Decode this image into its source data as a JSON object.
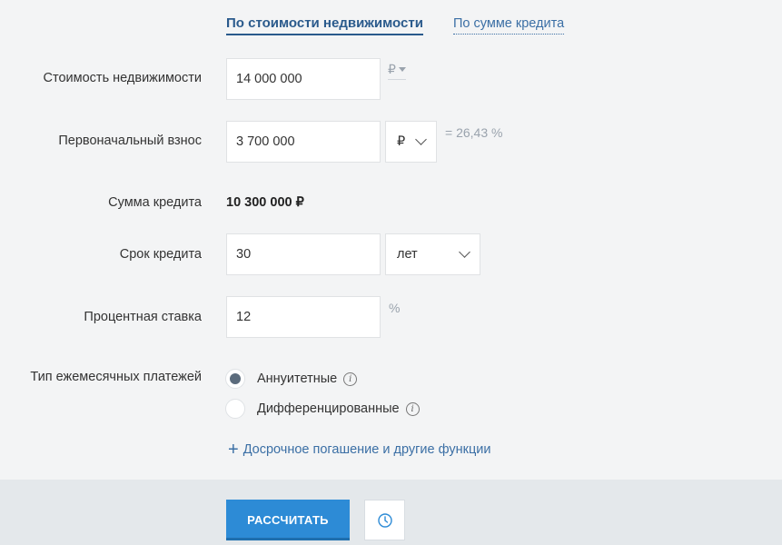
{
  "tabs": {
    "active": "По стоимости недвижимости",
    "other": "По сумме кредита"
  },
  "form": {
    "property_cost": {
      "label": "Стоимость недвижимости",
      "value": "14 000 000",
      "currency": "₽"
    },
    "down_payment": {
      "label": "Первоначальный взнос",
      "value": "3 700 000",
      "unit_selected": "₽",
      "percent_text": "= 26,43 %"
    },
    "loan_amount": {
      "label": "Сумма кредита",
      "value": "10 300 000 ₽"
    },
    "term": {
      "label": "Срок кредита",
      "value": "30",
      "unit_selected": "лет"
    },
    "rate": {
      "label": "Процентная ставка",
      "value": "12",
      "unit": "%"
    },
    "payment_type": {
      "label": "Тип ежемесячных платежей",
      "options": [
        {
          "label": "Аннуитетные",
          "selected": true
        },
        {
          "label": "Дифференцированные",
          "selected": false
        }
      ]
    },
    "extra_link": "Досрочное погашение и другие функции"
  },
  "footer": {
    "calculate_label": "РАССЧИТАТЬ"
  },
  "icons": {
    "info": "info-icon",
    "plus": "plus-icon",
    "history": "clock-icon"
  },
  "colors": {
    "accent": "#2d8bd6",
    "link": "#3b6fa5",
    "tab_active": "#2a5a8c"
  }
}
